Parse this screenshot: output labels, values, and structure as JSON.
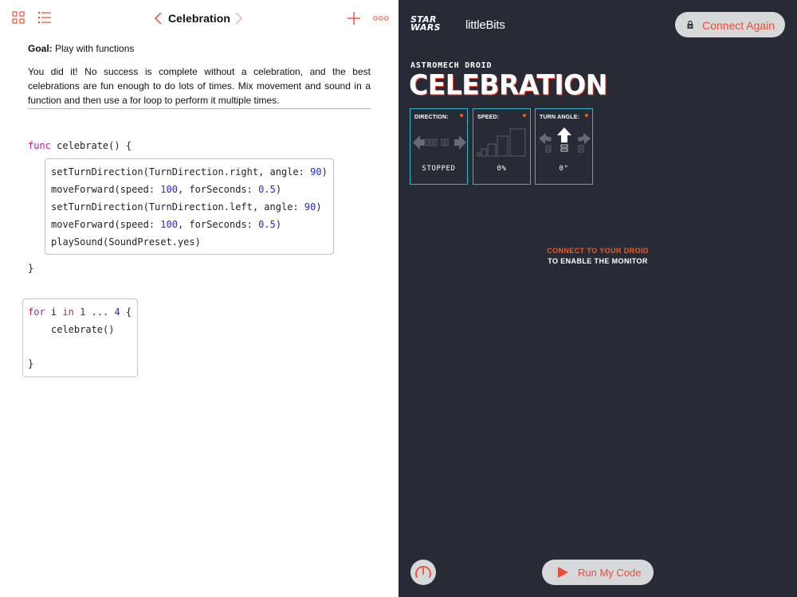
{
  "toolbar": {
    "title": "Celebration",
    "icons": [
      "grid-icon",
      "list-icon",
      "chevron-left-icon",
      "chevron-right-icon",
      "plus-icon",
      "more-icon"
    ]
  },
  "content": {
    "goal_label": "Goal:",
    "goal_text": "Play with functions",
    "description": "You did it! No success is complete without a celebration, and the best celebrations are fun enough to do lots of times. Mix movement and sound in a function and then use a for loop to perform it multiple times."
  },
  "code": {
    "func_kw": "func",
    "func_sig": " celebrate() {",
    "body": [
      {
        "pre": "setTurnDirection(TurnDirection.right, angle: ",
        "num": "90",
        "post": ")"
      },
      {
        "pre": "moveForward(speed: ",
        "num": "100",
        "mid": ", forSeconds: ",
        "num2": "0.5",
        "post": ")"
      },
      {
        "pre": "setTurnDirection(TurnDirection.left, angle: ",
        "num": "90",
        "post": ")"
      },
      {
        "pre": "moveForward(speed: ",
        "num": "100",
        "mid": ", forSeconds: ",
        "num2": "0.5",
        "post": ")"
      },
      {
        "pre": "playSound(SoundPreset.yes)"
      }
    ],
    "close_brace": "}",
    "for_kw": "for",
    "for_var": " i ",
    "in_kw": "in",
    "range_start": "1",
    "range_op": " ... ",
    "range_end": "4",
    "for_open": " {",
    "for_body": "celebrate()",
    "for_close": "}"
  },
  "monitor": {
    "brand_line1": "STAR",
    "brand_line2": "WARS",
    "partner": "littleBits",
    "connect_button": "Connect Again",
    "subtitle": "ASTROMECH DROID",
    "title": "CELEBRATION",
    "panels": [
      {
        "label": "DIRECTION:",
        "value": "STOPPED"
      },
      {
        "label": "SPEED:",
        "value": "0%"
      },
      {
        "label": "TURN ANGLE:",
        "value": "0°"
      }
    ],
    "message_line1": "CONNECT TO YOUR DROID",
    "message_line2": "TO ENABLE THE MONITOR",
    "run_button": "Run My Code"
  },
  "colors": {
    "accent": "#e94e36",
    "panel_border": "#32b4c9",
    "dark_bg": "#262b36",
    "keyword": "#a6239a",
    "number": "#2529d2"
  }
}
